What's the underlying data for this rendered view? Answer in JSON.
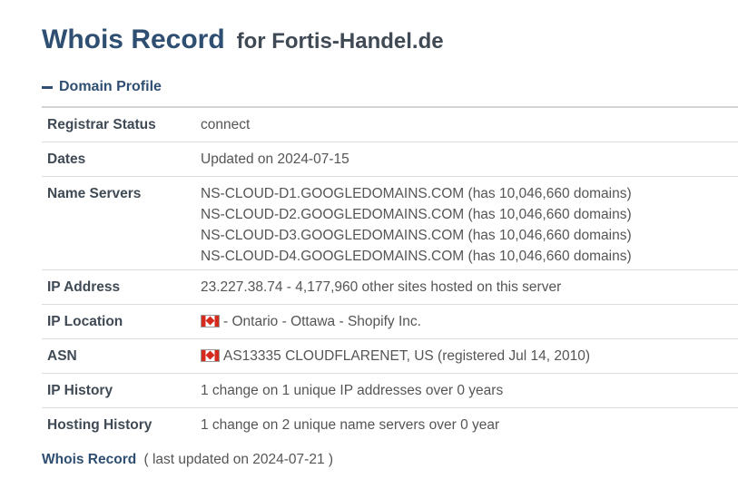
{
  "page_title": {
    "main": "Whois Record",
    "sub": "for Fortis-Handel.de"
  },
  "section": {
    "toggle_icon": "minus-icon",
    "label": "Domain Profile"
  },
  "profile": {
    "registrar_status": {
      "label": "Registrar Status",
      "value": "connect"
    },
    "dates": {
      "label": "Dates",
      "value": "Updated on 2024-07-15"
    },
    "name_servers": {
      "label": "Name Servers",
      "values": [
        "NS-CLOUD-D1.GOOGLEDOMAINS.COM (has 10,046,660 domains)",
        "NS-CLOUD-D2.GOOGLEDOMAINS.COM (has 10,046,660 domains)",
        "NS-CLOUD-D3.GOOGLEDOMAINS.COM (has 10,046,660 domains)",
        "NS-CLOUD-D4.GOOGLEDOMAINS.COM (has 10,046,660 domains)"
      ]
    },
    "ip_address": {
      "label": "IP Address",
      "value": "23.227.38.74 - 4,177,960 other sites hosted on this server"
    },
    "ip_location": {
      "label": "IP Location",
      "flag": "canada-flag-icon",
      "value": "- Ontario - Ottawa - Shopify Inc."
    },
    "asn": {
      "label": "ASN",
      "flag": "canada-flag-icon",
      "value": "AS13335 CLOUDFLARENET, US (registered Jul 14, 2010)"
    },
    "ip_history": {
      "label": "IP History",
      "value": "1 change on 1 unique IP addresses over 0 years"
    },
    "hosting_history": {
      "label": "Hosting History",
      "value": "1 change on 2 unique name servers over 0 year"
    }
  },
  "footer": {
    "link": "Whois Record",
    "note": "( last updated on 2024-07-21 )"
  },
  "colors": {
    "heading": "#2f4f72",
    "label": "#3f4a55",
    "text": "#555555",
    "divider": "#dcdcdc"
  }
}
